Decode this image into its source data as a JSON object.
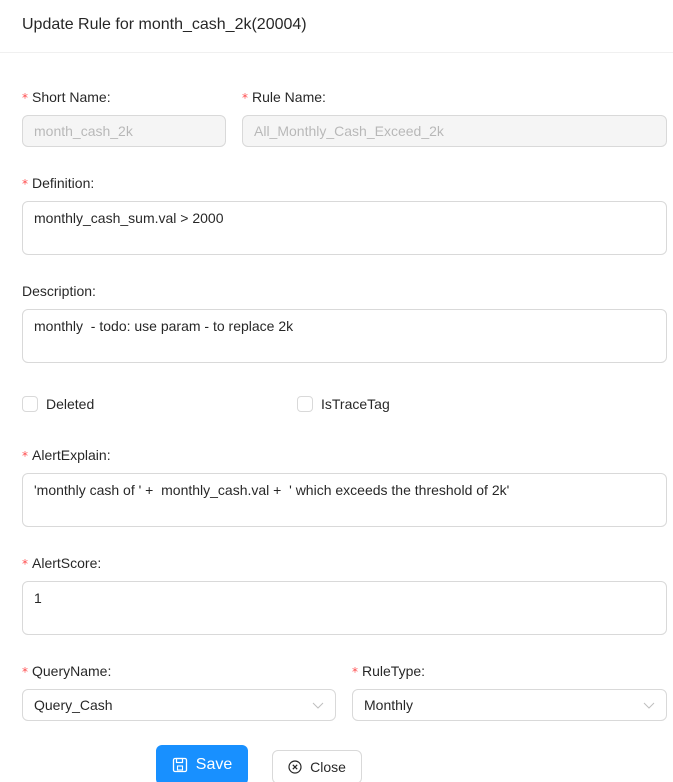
{
  "dialog": {
    "title": "Update Rule for month_cash_2k(20004)"
  },
  "form": {
    "required_mark": "*",
    "short_name": {
      "label": "Short Name:",
      "value": "month_cash_2k",
      "disabled": true,
      "required": true
    },
    "rule_name": {
      "label": "Rule Name:",
      "value": "All_Monthly_Cash_Exceed_2k",
      "disabled": true,
      "required": true
    },
    "definition": {
      "label": "Definition:",
      "value": "monthly_cash_sum.val > 2000",
      "required": true
    },
    "description": {
      "label": "Description:",
      "value": "monthly  - todo: use param - to replace 2k",
      "required": false
    },
    "deleted": {
      "label": "Deleted",
      "checked": false
    },
    "is_trace_tag": {
      "label": "IsTraceTag",
      "checked": false
    },
    "alert_explain": {
      "label": "AlertExplain:",
      "value": "'monthly cash of ' +  monthly_cash.val +  ' which exceeds the threshold of 2k'",
      "required": true
    },
    "alert_score": {
      "label": "AlertScore:",
      "value": "1",
      "required": true
    },
    "query_name": {
      "label": "QueryName:",
      "selected": "Query_Cash",
      "required": true
    },
    "rule_type": {
      "label": "RuleType:",
      "selected": "Monthly",
      "required": true
    }
  },
  "actions": {
    "save_label": "Save",
    "save_icon": "save-icon",
    "close_label": "Close",
    "close_icon": "close-circle-icon"
  },
  "colors": {
    "primary": "#1890ff",
    "required": "#ff4d4f",
    "border": "#d9d9d9",
    "disabled_bg": "#f5f5f5"
  }
}
